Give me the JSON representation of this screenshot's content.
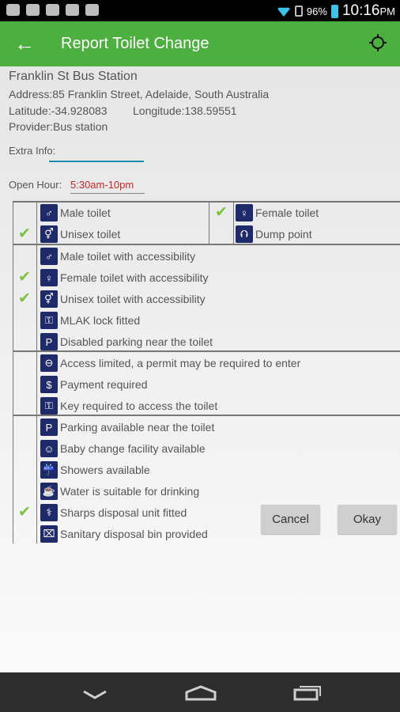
{
  "status_bar": {
    "battery": "96%",
    "time": "10:16",
    "ampm": "PM"
  },
  "app_bar": {
    "title": "Report Toilet Change"
  },
  "station": {
    "name": "Franklin St Bus Station",
    "address": "Address:85 Franklin Street, Adelaide, South Australia",
    "latitude": "Latitude:-34.928083",
    "longitude": "Longitude:138.59551",
    "provider": "Provider:Bus station"
  },
  "extra_info": {
    "label": "Extra Info:",
    "value": ""
  },
  "open_hour": {
    "label": "Open Hour:",
    "value": "5:30am-10pm"
  },
  "facilities": {
    "basic": [
      {
        "label": "Male toilet",
        "checked": false,
        "icon": "male-icon",
        "glyph": "♂"
      },
      {
        "label": "Female toilet",
        "checked": true,
        "icon": "female-icon",
        "glyph": "♀"
      },
      {
        "label": "Unisex toilet",
        "checked": true,
        "icon": "unisex-icon",
        "glyph": "⚥"
      },
      {
        "label": "Dump point",
        "checked": false,
        "icon": "dump-point-icon",
        "glyph": "⮉"
      }
    ],
    "accessibility": [
      {
        "label": "Male toilet with accessibility",
        "checked": false,
        "icon": "accessible-male-icon",
        "glyph": "♂"
      },
      {
        "label": "Female toilet with accessibility",
        "checked": true,
        "icon": "accessible-female-icon",
        "glyph": "♀"
      },
      {
        "label": "Unisex toilet with accessibility",
        "checked": true,
        "icon": "accessible-unisex-icon",
        "glyph": "⚥"
      },
      {
        "label": "MLAK lock fitted",
        "checked": false,
        "icon": "mlak-lock-icon",
        "glyph": "⚿"
      },
      {
        "label": "Disabled parking near the toilet",
        "checked": false,
        "icon": "disabled-parking-icon",
        "glyph": "P"
      }
    ],
    "access": [
      {
        "label": "Access limited, a permit may be required to enter",
        "checked": false,
        "icon": "no-entry-icon",
        "glyph": "⊖"
      },
      {
        "label": "Payment required",
        "checked": false,
        "icon": "payment-icon",
        "glyph": "$"
      },
      {
        "label": "Key required to access the toilet",
        "checked": false,
        "icon": "key-icon",
        "glyph": "⚿"
      }
    ],
    "amenities": [
      {
        "label": "Parking available near the toilet",
        "checked": false,
        "icon": "parking-icon",
        "glyph": "P"
      },
      {
        "label": "Baby change facility available",
        "checked": false,
        "icon": "baby-change-icon",
        "glyph": "☺"
      },
      {
        "label": "Showers available",
        "checked": false,
        "icon": "shower-icon",
        "glyph": "☔"
      },
      {
        "label": "Water is suitable for drinking",
        "checked": false,
        "icon": "drinking-water-icon",
        "glyph": "☕"
      },
      {
        "label": "Sharps disposal unit fitted",
        "checked": true,
        "icon": "sharps-disposal-icon",
        "glyph": "⚕"
      },
      {
        "label": "Sanitary disposal bin provided",
        "checked": false,
        "icon": "sanitary-bin-icon",
        "glyph": "⌧"
      }
    ]
  },
  "buttons": {
    "cancel": "Cancel",
    "okay": "Okay"
  },
  "colors": {
    "accent": "#4caf3f",
    "check": "#7cc142",
    "icon_bg": "#1f2a6b",
    "hours": "#c62828",
    "field_line": "#1c8ca8"
  }
}
